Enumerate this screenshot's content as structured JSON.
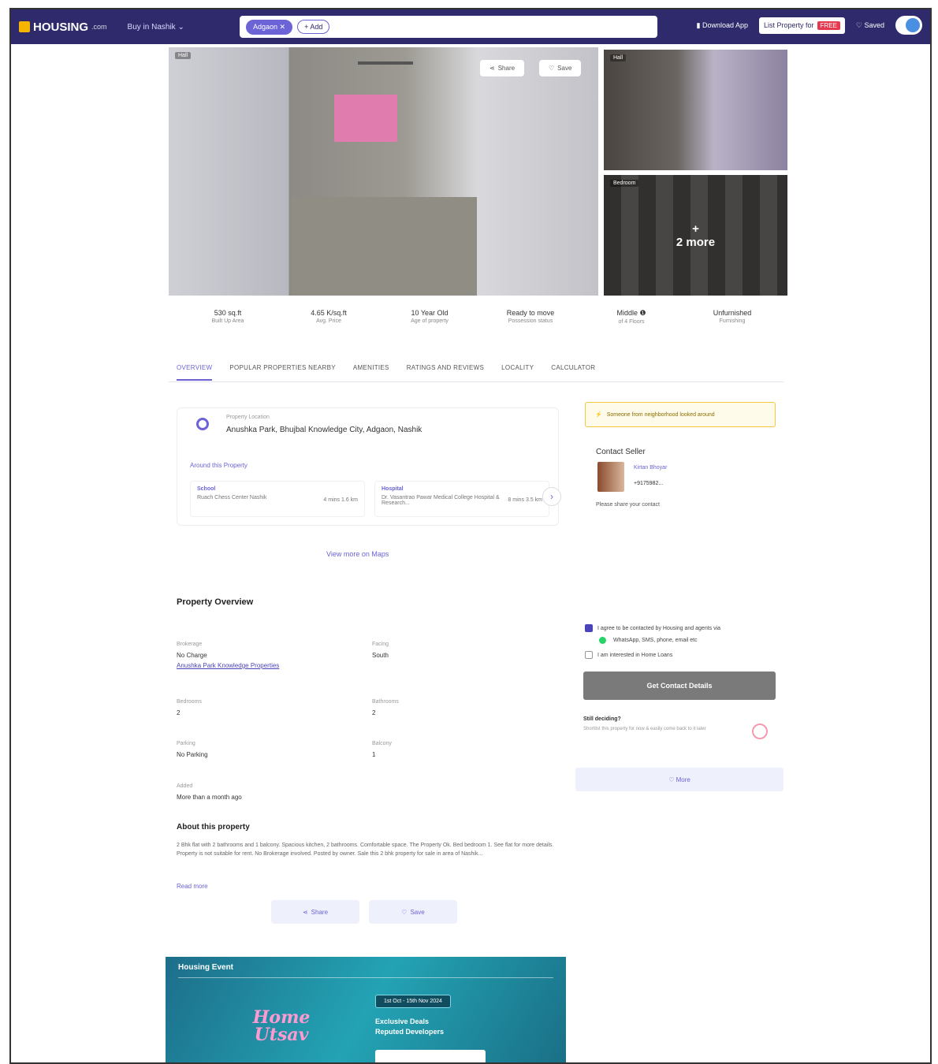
{
  "header": {
    "logo_text": "HOUSING",
    "logo_suffix": ".com",
    "buy_menu": "Buy in Nashik ⌄",
    "search_chips": [
      "Adgaon ✕",
      "+ Add"
    ],
    "download_app": "▮ Download App",
    "post_property": "List Property for",
    "free_badge": "FREE",
    "saved": "♡ Saved"
  },
  "gallery": {
    "main_tag": "Hall",
    "share_label": "Share",
    "save_label": "Save",
    "side1_tag": "Hall",
    "side2_tag": "Bedroom",
    "more_plus": "+",
    "more_label": "2 more"
  },
  "stats": [
    {
      "value": "530 sq.ft",
      "label": "Built Up Area"
    },
    {
      "value": "4.65 K/sq.ft",
      "label": "Avg. Price"
    },
    {
      "value": "10 Year Old",
      "label": "Age of property"
    },
    {
      "value": "Ready to move",
      "label": "Possession status"
    },
    {
      "value": "Middle ❶",
      "label": "of 4 Floors"
    },
    {
      "value": "Unfurnished",
      "label": "Furnishing"
    }
  ],
  "tabs": [
    "OVERVIEW",
    "POPULAR PROPERTIES NEARBY",
    "AMENITIES",
    "RATINGS AND REVIEWS",
    "LOCALITY",
    "CALCULATOR"
  ],
  "location": {
    "label": "Property Location",
    "value": "Anushka Park, Bhujbal Knowledge City, Adgaon, Nashik",
    "around": "Around this Property",
    "pois": [
      {
        "type": "School",
        "name": "Ruach Chess Center Nashik",
        "dist": "4 mins 1.6 km"
      },
      {
        "type": "Hospital",
        "name": "Dr. Vasantrao Pawar Medical College Hospital & Research...",
        "dist": "8 mins 3.5 km"
      }
    ],
    "view_map": "View more on Maps"
  },
  "overview": {
    "title": "Property Overview",
    "items": [
      {
        "label": "Brokerage",
        "value": "No Charge",
        "link": "Anushka Park Knowledge Properties"
      },
      {
        "label": "Facing",
        "value": "South"
      },
      {
        "label": "Bedrooms",
        "value": "2"
      },
      {
        "label": "Bathrooms",
        "value": "2"
      },
      {
        "label": "Parking",
        "value": "No Parking"
      },
      {
        "label": "Balcony",
        "value": "1"
      },
      {
        "label": "Added",
        "value": "More than a month ago"
      }
    ]
  },
  "about": {
    "title": "About this property",
    "text": "2 Bhk flat with 2 bathrooms and 1 balcony. Spacious kitchen, 2 bathrooms. Comfortable space. The Property Ok. Bed bedroom 1. See flat for more details. Property is not suitable for rent. No Brokerage involved. Posted by owner. Sale this 2 bhk property for sale in area of Nashik...",
    "read_more": "Read more",
    "share": "Share",
    "save": "Save"
  },
  "banner": {
    "title": "Housing Event",
    "logo_line1": "Home",
    "logo_line2": "Utsav",
    "date": "1st Oct - 15th Nov 2024",
    "copy_line1": "Exclusive Deals",
    "copy_line2": "Reputed Developers"
  },
  "contact": {
    "alert": "Someone from neighborhood looked around",
    "title": "Contact Seller",
    "seller_name": "Kirtan Bhoyar",
    "seller_phone": "+9175982...",
    "share_note": "Please share your contact",
    "consent1": "I agree to be contacted by Housing and agents via",
    "consent1b": "WhatsApp, SMS, phone, email etc",
    "consent2": "I am interested in Home Loans",
    "get_details": "Get Contact Details",
    "still": "Still deciding?",
    "still_sub": "Shortlist this property for now & easily come back to it later",
    "more": "♡ More"
  },
  "colors": {
    "accent": "#6b63d6",
    "topbar": "#2e2a6b",
    "free": "#e53950"
  }
}
